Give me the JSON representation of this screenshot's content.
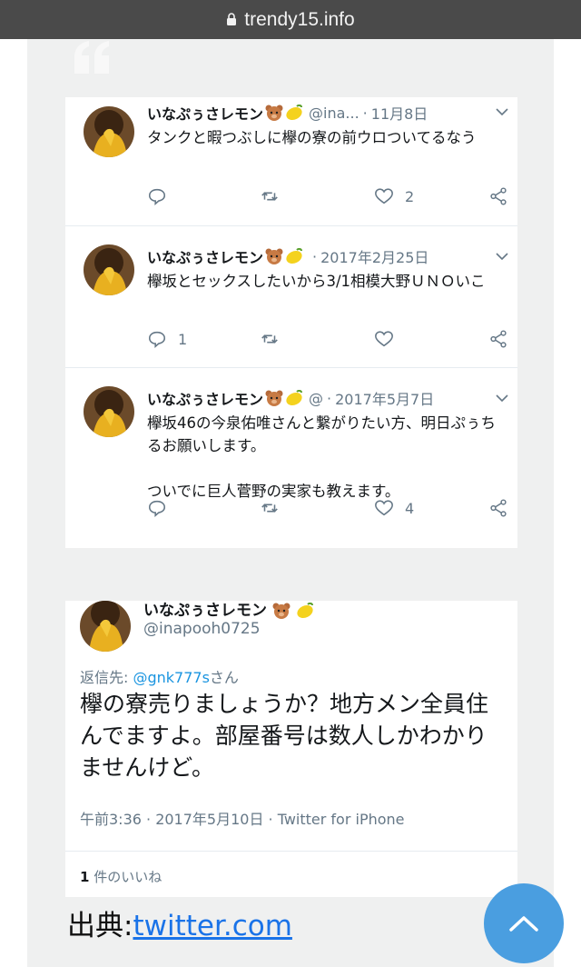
{
  "browser": {
    "url": "trendy15.info"
  },
  "tweets": [
    {
      "name": "いなぷぅさレモン",
      "handle": "@ina...",
      "date": "11月8日",
      "text": "タンクと暇つぶしに欅の寮の前ウロついてるなう",
      "replies": "",
      "likes": "2"
    },
    {
      "name": "いなぷぅさレモン",
      "handle": "",
      "date": "2017年2月25日",
      "text": "欅坂とセックスしたいから3/1相模大野ＵＮＯいこ",
      "replies": "1",
      "likes": ""
    },
    {
      "name": "いなぷぅさレモン",
      "handle": "@",
      "date": "2017年5月7日",
      "text": "欅坂46の今泉佑唯さんと繋がりたい方、明日ぷぅちるお願いします。\n\nついでに巨人菅野の実家も教えます。",
      "replies": "",
      "likes": "4"
    }
  ],
  "screenshot_tweet": {
    "name": "いなぷぅさレモン",
    "handle": "@inapooh0725",
    "reply_prefix": "返信先: ",
    "reply_mention": "@gnk777s",
    "reply_suffix": "さん",
    "text": "欅の寮売りましょうか？地方メン全員住んでますよ。部屋番号は数人しかわかりませんけど。",
    "meta": "午前3:36 · 2017年5月10日 · Twitter for iPhone",
    "likes_count": "1",
    "likes_label": " 件のいいね"
  },
  "source": {
    "label": "出典:",
    "link": "twitter.com"
  },
  "colors": {
    "accent": "#1b95e0",
    "fab": "#4a9ee0",
    "page_bg": "#eff0f0",
    "urlbar": "#4a4a4a"
  }
}
